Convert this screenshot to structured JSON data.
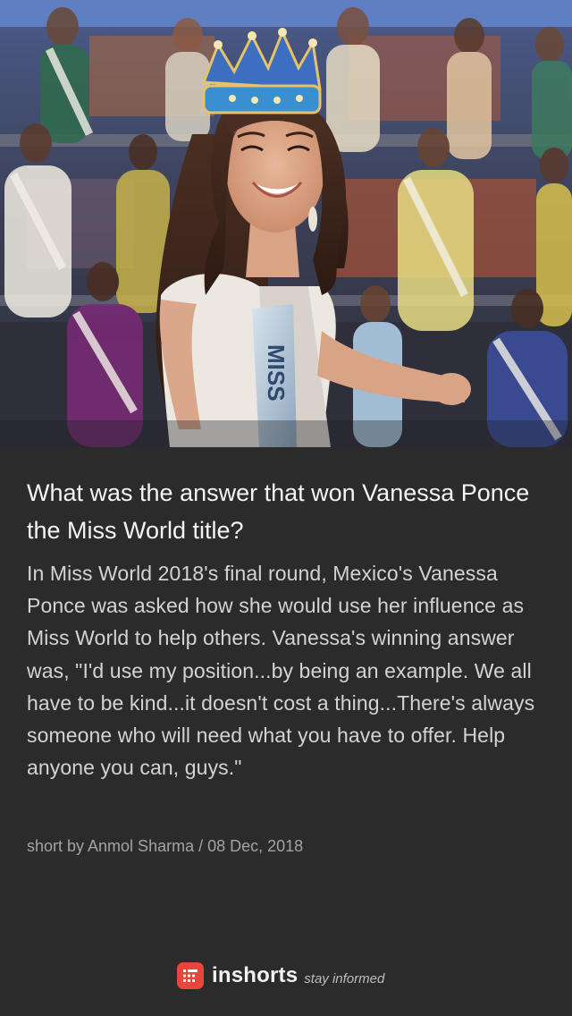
{
  "article": {
    "headline": "What was the answer that won Vanessa Ponce the Miss World title?",
    "body": "In Miss World 2018's final round, Mexico's Vanessa Ponce was asked how she would use her influence as Miss World to help others. Vanessa's winning answer was, \"I'd use my position...by being an example. We all have to be kind...it doesn't cost a thing...There's always someone who will need what you have to offer. Help anyone you can, guys.\"",
    "byline": "short by Anmol Sharma / 08 Dec, 2018",
    "image": {
      "sash_text": "MISS"
    }
  },
  "brand": {
    "name": "inshorts",
    "tagline": "stay informed",
    "logo_icon": "inshorts-logo-icon",
    "accent_color": "#e8453c"
  },
  "colors": {
    "background": "#2b2b2b",
    "headline": "#f4f4f4",
    "body": "#d3d3d3",
    "byline": "#a3a3a3"
  }
}
